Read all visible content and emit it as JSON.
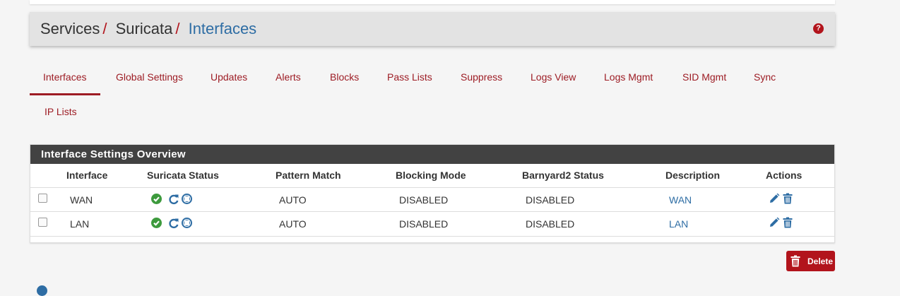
{
  "breadcrumb": {
    "items": [
      "Services",
      "Suricata"
    ],
    "separator": "/",
    "current": "Interfaces"
  },
  "help_icon": "question-circle-icon",
  "tabs": [
    {
      "label": "Interfaces",
      "active": true
    },
    {
      "label": "Global Settings"
    },
    {
      "label": "Updates"
    },
    {
      "label": "Alerts"
    },
    {
      "label": "Blocks"
    },
    {
      "label": "Pass Lists"
    },
    {
      "label": "Suppress"
    },
    {
      "label": "Logs View"
    },
    {
      "label": "Logs Mgmt"
    },
    {
      "label": "SID Mgmt"
    },
    {
      "label": "Sync"
    },
    {
      "label": "IP Lists"
    }
  ],
  "panel": {
    "title": "Interface Settings Overview",
    "columns": [
      "Interface",
      "Suricata Status",
      "Pattern Match",
      "Blocking Mode",
      "Barnyard2 Status",
      "Description",
      "Actions"
    ],
    "rows": [
      {
        "interface": "WAN",
        "status_icons": [
          "check-circle-icon",
          "refresh-icon",
          "stop-circle-icon"
        ],
        "pattern_match": "AUTO",
        "blocking_mode": "DISABLED",
        "barnyard2_status": "DISABLED",
        "description": "WAN"
      },
      {
        "interface": "LAN",
        "status_icons": [
          "check-circle-icon",
          "refresh-icon",
          "stop-circle-icon"
        ],
        "pattern_match": "AUTO",
        "blocking_mode": "DISABLED",
        "barnyard2_status": "DISABLED",
        "description": "LAN"
      }
    ]
  },
  "delete_button": {
    "label": "Delete",
    "icon": "trash-icon"
  },
  "colors": {
    "brand_red": "#b2141c",
    "tab_red": "#9d1c24",
    "link_blue": "#2e6da4",
    "panel_header": "#424242",
    "ok_green": "#3d9a3d"
  }
}
